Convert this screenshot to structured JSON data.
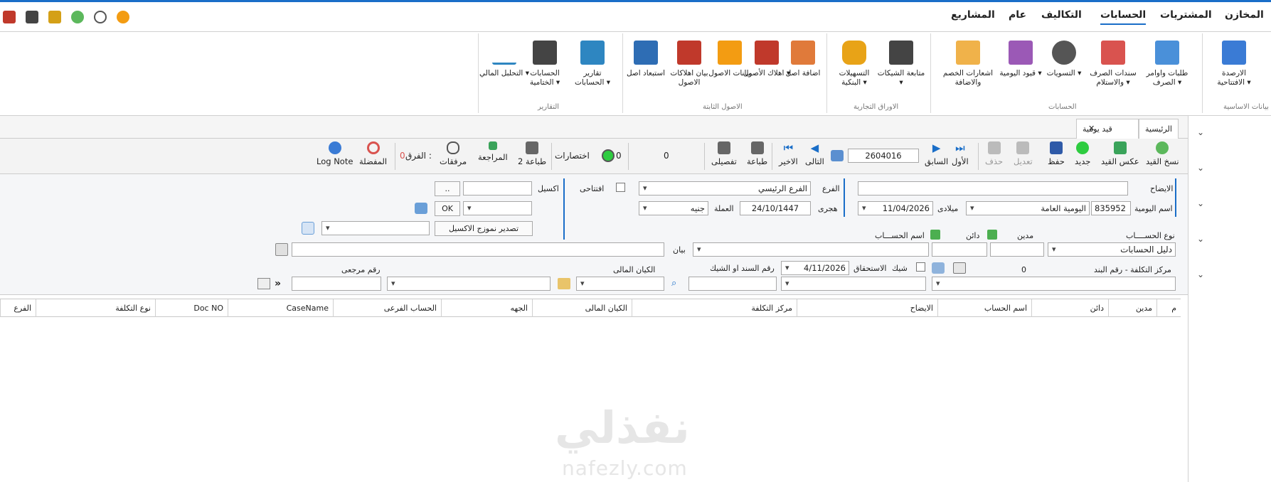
{
  "menu": {
    "items": [
      "المخازن",
      "المشتريات",
      "الحسابات",
      "التكاليف",
      "عام",
      "المشاريع"
    ],
    "active": "الحسابات"
  },
  "ribbon": {
    "groups": [
      {
        "label": "بيانات الاساسية",
        "buttons": [
          {
            "label": "الارصدة الافتتاحية ▾",
            "icon": "balance-sheet-icon",
            "color": "#3a7bd5"
          }
        ]
      },
      {
        "label": "الحسابات",
        "buttons": [
          {
            "label": "طلبات واوامر الصرف ▾",
            "icon": "payment-order-icon",
            "color": "#4a90d9"
          },
          {
            "label": "سندات الصرف والاستلام ▾",
            "icon": "receipt-voucher-icon",
            "color": "#d9534f"
          },
          {
            "label": "التسويات ▾",
            "icon": "user-info-icon",
            "color": "#555555"
          },
          {
            "label": "قيود اليومية ▾",
            "icon": "journal-icon",
            "color": "#9b59b6"
          },
          {
            "label": "اشعارات الخصم والاضافة",
            "icon": "note-pin-icon",
            "color": "#f0b24a"
          }
        ]
      },
      {
        "label": "الاوراق التجارية",
        "buttons": [
          {
            "label": "متابعة الشيكات ▾",
            "icon": "bank-icon",
            "color": "#444444"
          },
          {
            "label": "التسهيلات البنكية ▾",
            "icon": "coins-stack-icon",
            "color": "#e8a317"
          }
        ]
      },
      {
        "label": "الاصول الثابتة",
        "buttons": [
          {
            "label": "اضافة اصل",
            "icon": "add-asset-grid-icon",
            "color": "#e07a3a"
          },
          {
            "label": "اهلاك الأصول ▾",
            "icon": "sigma-icon",
            "color": "#c0392b"
          },
          {
            "label": "بيانات الاصول",
            "icon": "folders-icon",
            "color": "#f39c12"
          },
          {
            "label": "بيان اهلاكات الاصول",
            "icon": "binders-icon",
            "color": "#c0392b"
          },
          {
            "label": "استبعاد اصل",
            "icon": "remove-asset-grid-icon",
            "color": "#2e6db4"
          }
        ]
      },
      {
        "label": "التقارير",
        "buttons": [
          {
            "label": "تقارير الحسابات ▾",
            "icon": "report-stack-icon",
            "color": "#2e86c1"
          },
          {
            "label": "الحسابات الختامية ▾",
            "icon": "final-accounts-icon",
            "color": "#444444"
          },
          {
            "label": "التحلبل المالي ▾",
            "icon": "line-chart-icon",
            "color": "#2e86c1"
          }
        ]
      }
    ]
  },
  "tabs": {
    "home": "الرئيسية",
    "journal": "قيد يومية",
    "close": "✕"
  },
  "toolbar": {
    "copy_entry": "نسخ القيد",
    "reverse_entry": "عكس القيد",
    "new": "جديد",
    "save": "حفظ",
    "edit": "تعديل",
    "delete": "حذف",
    "first": "الأول",
    "previous": "السابق",
    "record_no": "2604016",
    "next": "التالى",
    "last": "الاخير",
    "print": "طباعة",
    "detailed": "تفصيلى",
    "count_a": "0",
    "count_b": "0",
    "shortcuts": "اختصارات",
    "print2": "طباعة 2",
    "review": "المراجعة",
    "attachments": "مرفقات",
    "diff_label": "الفرق :",
    "diff_value": "0",
    "favorites": "المفضلة",
    "log_note": "Log Note"
  },
  "form": {
    "description_label": "الايضاح",
    "journal_name_label": "اسم اليومية",
    "journal_code": "835952",
    "journal_name": "اليومية العامة",
    "gregorian_label": "ميلادى",
    "gregorian_date": "11/04/2026",
    "hijri_label": "هجرى",
    "hijri_date": "24/10/1447",
    "branch_label": "الفرع",
    "branch_value": "الفرع الرئيسي",
    "currency_label": "العملة",
    "currency_value": "جنيه",
    "opening_label": "افتتاحى",
    "excel_label": "اكسيل",
    "browse": "..",
    "ok": "OK",
    "export_excel": "تصدير نموزج الاكسيل",
    "account_type_label": "نوع الحســــاب",
    "account_type_value": "دليل الحسابات",
    "debit_label": "مدين",
    "credit_label": "دائن",
    "account_name_label": "اسم الحســـاب",
    "statement_label": "بيان",
    "cost_center_label": "مركز التكلفة - رقم البند",
    "cost_center_count": "0",
    "check_label": "شيك",
    "due_label": "الاستحقاق",
    "due_date": "4/11/2026",
    "doc_check_label": "رقم السند او الشيك",
    "financial_entity_label": "الكيان المالى",
    "reference_label": "رقم مرجعى"
  },
  "grid": {
    "columns": [
      "م",
      "مدين",
      "دائن",
      "اسم الحساب",
      "الايضاح",
      "مركز التكلفة",
      "الكيان المالى",
      "الجهه",
      "الحساب الفرعى",
      "CaseName",
      "Doc NO",
      "نوع التكلفة",
      "الفرع"
    ]
  },
  "watermark": {
    "logo": "نفذلي",
    "site": "nafezly.com"
  }
}
